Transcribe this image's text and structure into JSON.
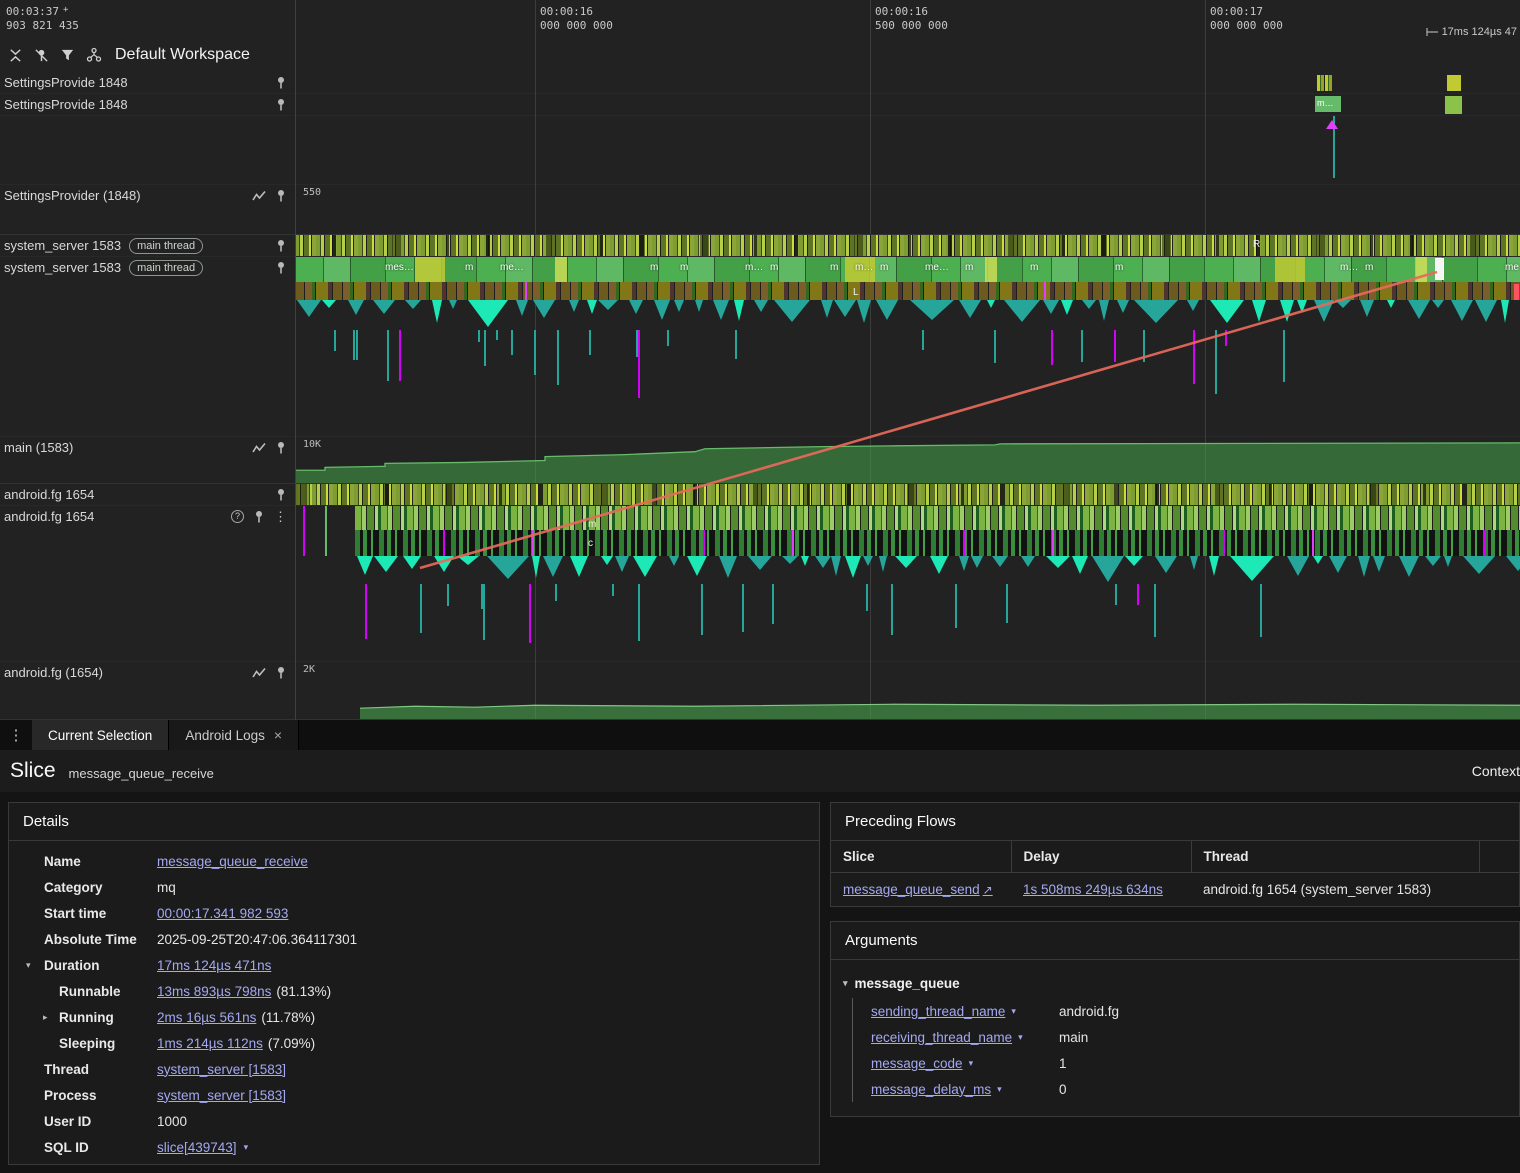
{
  "header": {
    "left_time": "00:03:37",
    "left_plus": "+",
    "left_offset": "903 821 435",
    "ticks": [
      {
        "t1": "00:00:16",
        "t2": "000 000 000"
      },
      {
        "t1": "00:00:16",
        "t2": "500 000 000"
      },
      {
        "t1": "00:00:17",
        "t2": "000 000 000"
      }
    ],
    "duration_marker": "17ms 124µs 47"
  },
  "toolbar": {
    "workspace_label": "Default Workspace"
  },
  "tracks": [
    {
      "label": "SettingsProvide 1848"
    },
    {
      "label": "SettingsProvide 1848"
    },
    {
      "label": "SettingsProvider (1848)",
      "scale": "550"
    },
    {
      "label": "system_server 1583",
      "badge": "main thread"
    },
    {
      "label": "system_server 1583",
      "badge": "main thread"
    },
    {
      "label": "main (1583)",
      "scale": "10K"
    },
    {
      "label": "android.fg 1654"
    },
    {
      "label": "android.fg 1654"
    },
    {
      "label": "android.fg (1654)",
      "scale": "2K"
    }
  ],
  "timeline": {
    "sys_labels": [
      "mes…",
      "m",
      "me…",
      "m",
      "m",
      "m…",
      "m",
      "m",
      "m…",
      "m",
      "me…",
      "m",
      "m",
      "m",
      "m…",
      "m",
      "me"
    ],
    "small_slice_label": "m…",
    "letter_r": "R",
    "letter_l": "L",
    "letter_m": "m",
    "letter_c": "c"
  },
  "icons": {
    "kebab": "⋮",
    "close": "×",
    "help": "?",
    "caret": "▾",
    "expand_open": "▾",
    "expand_closed": "▸",
    "flow_arrow": "↗"
  },
  "tabs": {
    "items": [
      {
        "label": "Current Selection"
      },
      {
        "label": "Android Logs"
      }
    ]
  },
  "selection": {
    "kind": "Slice",
    "title": "message_queue_receive",
    "context": "Context"
  },
  "details": {
    "heading": "Details",
    "rows": [
      {
        "label": "Name",
        "value": "message_queue_receive"
      },
      {
        "label": "Category",
        "value": "mq"
      },
      {
        "label": "Start time",
        "value": "00:00:17.341 982 593"
      },
      {
        "label": "Absolute Time",
        "value": "2025-09-25T20:47:06.364117301"
      },
      {
        "label": "Duration",
        "value": "17ms 124µs 471ns"
      },
      {
        "label": "Runnable",
        "value": "13ms 893µs 798ns",
        "suffix": "(81.13%)"
      },
      {
        "label": "Running",
        "value": "2ms 16µs 561ns",
        "suffix": "(11.78%)"
      },
      {
        "label": "Sleeping",
        "value": "1ms 214µs 112ns",
        "suffix": "(7.09%)"
      },
      {
        "label": "Thread",
        "value": "system_server [1583]"
      },
      {
        "label": "Process",
        "value": "system_server [1583]"
      },
      {
        "label": "User ID",
        "value": "1000"
      },
      {
        "label": "SQL ID",
        "value": "slice[439743]"
      }
    ]
  },
  "preceding_flows": {
    "heading": "Preceding Flows",
    "columns": [
      "Slice",
      "Delay",
      "Thread"
    ],
    "rows": [
      {
        "slice": "message_queue_send",
        "delay": "1s 508ms 249µs 634ns",
        "thread": "android.fg 1654 (system_server 1583)"
      }
    ]
  },
  "arguments": {
    "heading": "Arguments",
    "group": "message_queue",
    "rows": [
      {
        "key": "sending_thread_name",
        "value": "android.fg"
      },
      {
        "key": "receiving_thread_name",
        "value": "main"
      },
      {
        "key": "message_code",
        "value": "1"
      },
      {
        "key": "message_delay_ms",
        "value": "0"
      }
    ]
  }
}
